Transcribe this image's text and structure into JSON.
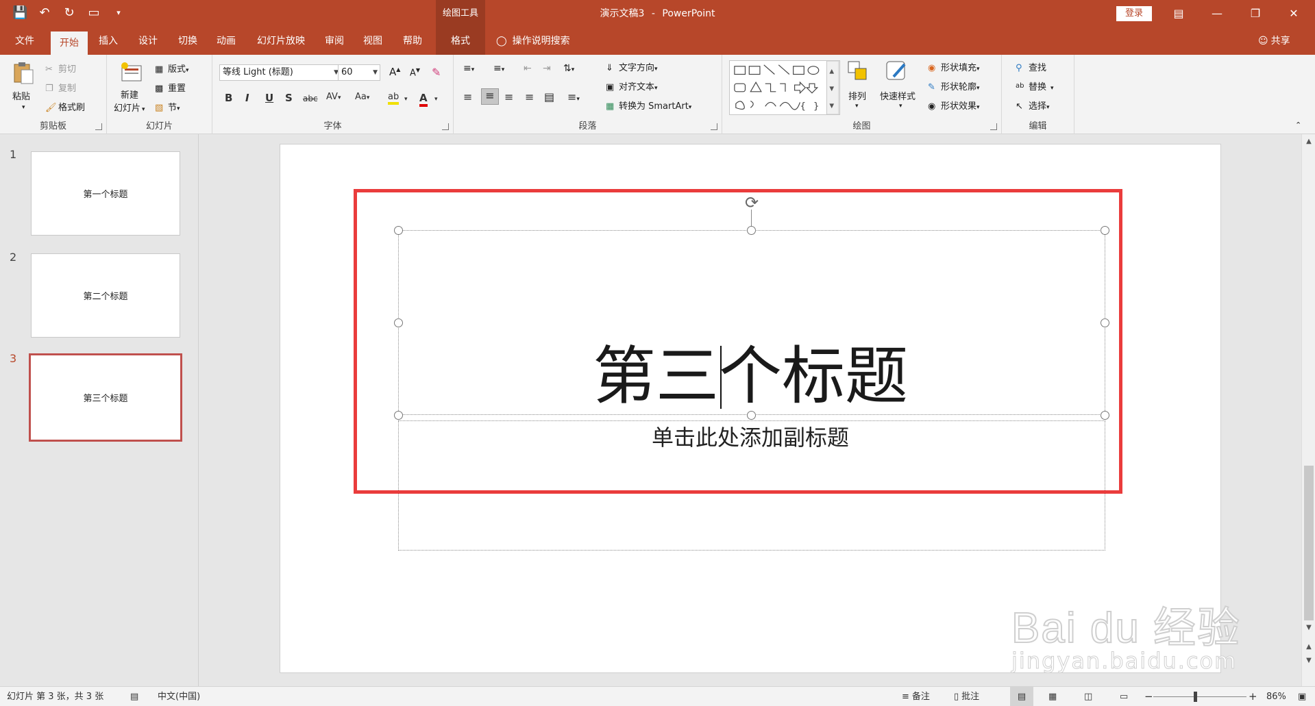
{
  "titlebar": {
    "context_tools": "绘图工具",
    "doc_name": "演示文稿3",
    "separator": "-",
    "app_name": "PowerPoint",
    "login": "登录"
  },
  "tabs": {
    "file": "文件",
    "home": "开始",
    "insert": "插入",
    "design": "设计",
    "transitions": "切换",
    "animations": "动画",
    "slideshow": "幻灯片放映",
    "review": "审阅",
    "view": "视图",
    "help": "帮助",
    "format": "格式",
    "search": "操作说明搜索",
    "share": "共享"
  },
  "ribbon": {
    "clipboard": {
      "paste": "粘贴",
      "cut": "剪切",
      "copy": "复制",
      "format_painter": "格式刷",
      "label": "剪贴板"
    },
    "slides": {
      "new_slide_line1": "新建",
      "new_slide_line2": "幻灯片",
      "layout": "版式",
      "reset": "重置",
      "section": "节",
      "label": "幻灯片"
    },
    "font": {
      "name": "等线 Light (标题)",
      "size": "60",
      "bold": "B",
      "italic": "I",
      "underline": "U",
      "shadow": "S",
      "strike": "abc",
      "spacing": "AV",
      "case": "Aa",
      "grow": "A",
      "shrink": "A",
      "label": "字体"
    },
    "paragraph": {
      "text_direction": "文字方向",
      "align_text": "对齐文本",
      "smartart": "转换为 SmartArt",
      "label": "段落"
    },
    "drawing": {
      "arrange": "排列",
      "quick_styles": "快速样式",
      "shape_fill": "形状填充",
      "shape_outline": "形状轮廓",
      "shape_effects": "形状效果",
      "label": "绘图"
    },
    "editing": {
      "find": "查找",
      "replace": "替换",
      "select": "选择",
      "label": "编辑"
    }
  },
  "thumbnails": [
    {
      "num": "1",
      "title": "第一个标题"
    },
    {
      "num": "2",
      "title": "第二个标题"
    },
    {
      "num": "3",
      "title": "第三个标题"
    }
  ],
  "slide": {
    "title": "第三个标题",
    "subtitle_placeholder": "单击此处添加副标题"
  },
  "watermark": {
    "main": "Bai du 经验",
    "sub": "jingyan.baidu.com"
  },
  "statusbar": {
    "slide_info": "幻灯片 第 3 张，共 3 张",
    "language": "中文(中国)",
    "notes": "备注",
    "comments": "批注",
    "zoom_out": "−",
    "zoom_in": "+",
    "zoom": "86%",
    "zoom_level": 0.45
  },
  "colors": {
    "accent": "#b7472a",
    "highlight_box": "#ea3c3c"
  }
}
